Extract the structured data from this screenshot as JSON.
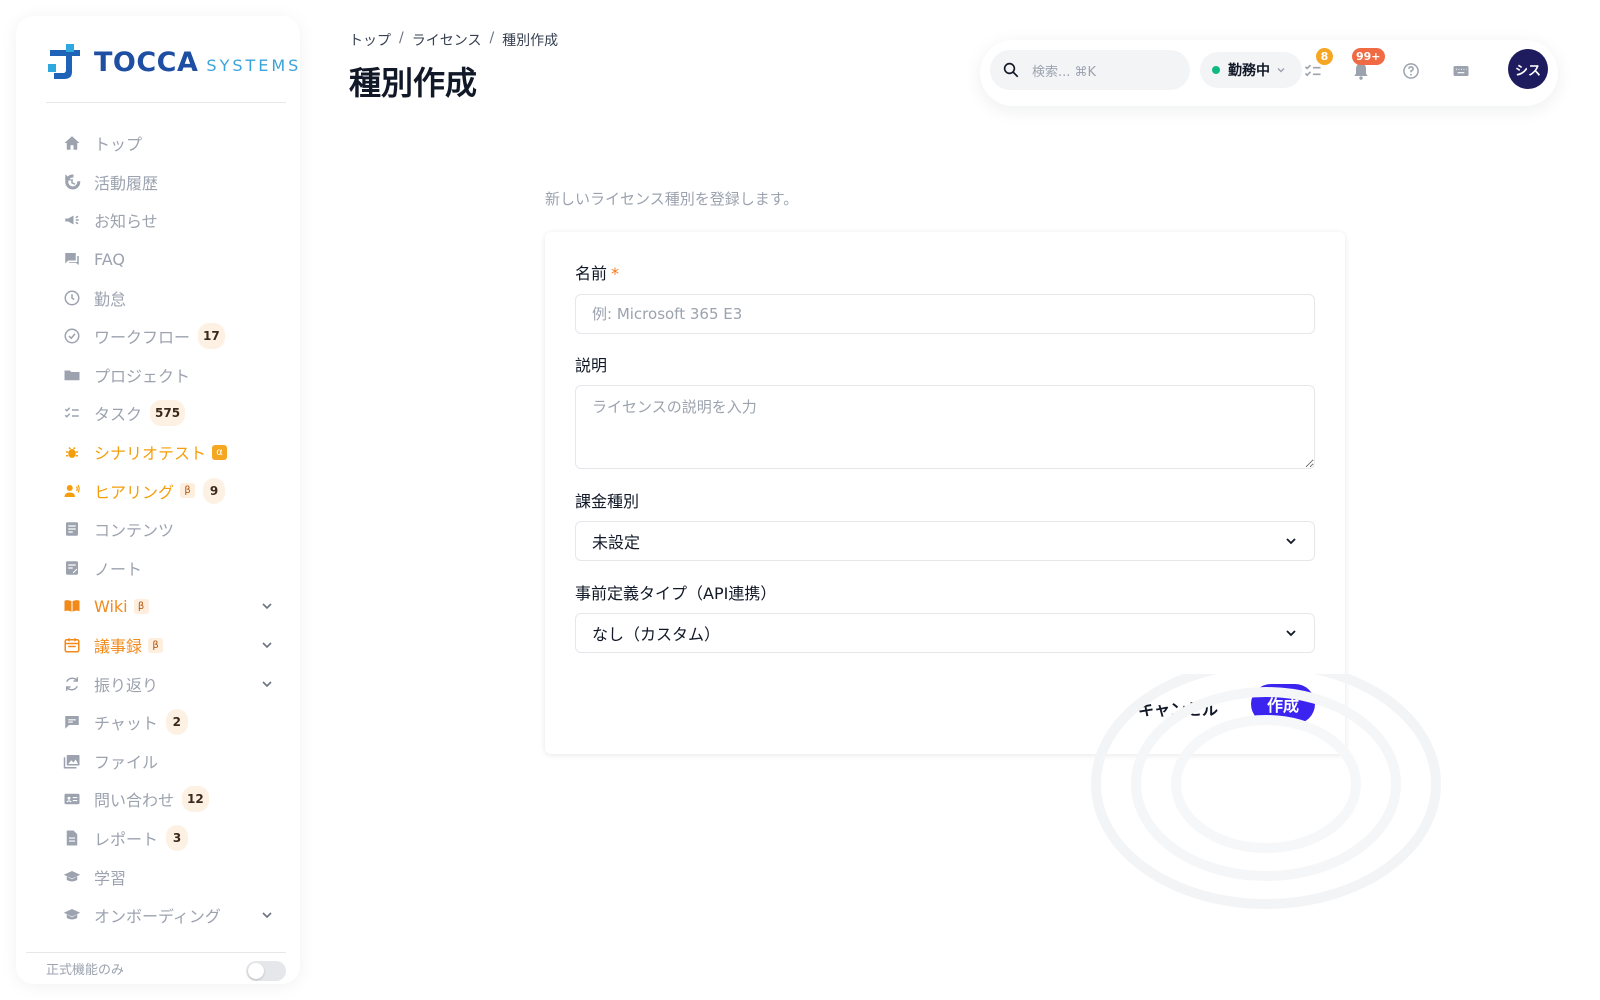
{
  "brand": {
    "name": "TOCCA",
    "sub": "SYSTEMS"
  },
  "breadcrumb": [
    "トップ",
    "ライセンス",
    "種別作成"
  ],
  "page_title": "種別作成",
  "topbar": {
    "search_placeholder": "検索... ⌘K",
    "status_label": "勤務中",
    "task_count": "8",
    "notification_count": "99+",
    "avatar_label": "シス"
  },
  "sidebar": {
    "items": [
      {
        "label": "トップ",
        "icon": "home-icon"
      },
      {
        "label": "活動履歴",
        "icon": "history-icon"
      },
      {
        "label": "お知らせ",
        "icon": "megaphone-icon"
      },
      {
        "label": "FAQ",
        "icon": "forum-icon"
      },
      {
        "label": "勤怠",
        "icon": "clock-icon"
      },
      {
        "label": "ワークフロー",
        "icon": "check-circle-icon",
        "badge": "17"
      },
      {
        "label": "プロジェクト",
        "icon": "folder-icon"
      },
      {
        "label": "タスク",
        "icon": "checklist-icon",
        "badge": "575"
      },
      {
        "label": "シナリオテスト",
        "icon": "bug-icon",
        "tag": "α"
      },
      {
        "label": "ヒアリング",
        "icon": "interview-icon",
        "tag": "β",
        "badge": "9"
      },
      {
        "label": "コンテンツ",
        "icon": "article-icon"
      },
      {
        "label": "ノート",
        "icon": "note-icon"
      },
      {
        "label": "Wiki",
        "icon": "book-icon",
        "tag": "β"
      },
      {
        "label": "議事録",
        "icon": "calendar-icon",
        "tag": "β"
      },
      {
        "label": "振り返り",
        "icon": "refresh-icon"
      },
      {
        "label": "チャット",
        "icon": "chat-icon",
        "badge": "2"
      },
      {
        "label": "ファイル",
        "icon": "image-icon"
      },
      {
        "label": "問い合わせ",
        "icon": "contact-card-icon",
        "badge": "12"
      },
      {
        "label": "レポート",
        "icon": "document-icon",
        "badge": "3"
      },
      {
        "label": "学習",
        "icon": "school-icon"
      },
      {
        "label": "オンボーディング",
        "icon": "school-icon"
      }
    ],
    "footer_label": "正式機能のみ"
  },
  "form": {
    "intro": "新しいライセンス種別を登録します。",
    "name_label": "名前",
    "required_mark": "*",
    "name_placeholder": "例: Microsoft 365 E3",
    "description_label": "説明",
    "description_placeholder": "ライセンスの説明を入力",
    "billing_label": "課金種別",
    "billing_value": "未設定",
    "predefined_label": "事前定義タイプ（API連携）",
    "predefined_value": "なし（カスタム）",
    "cancel_label": "キャンセル",
    "create_label": "作成"
  },
  "colors": {
    "accent": "#3b24f0",
    "brand": "#1e4fa3",
    "orange": "#f59e0b",
    "status_green": "#10b981",
    "avatar": "#1e1b5e"
  }
}
